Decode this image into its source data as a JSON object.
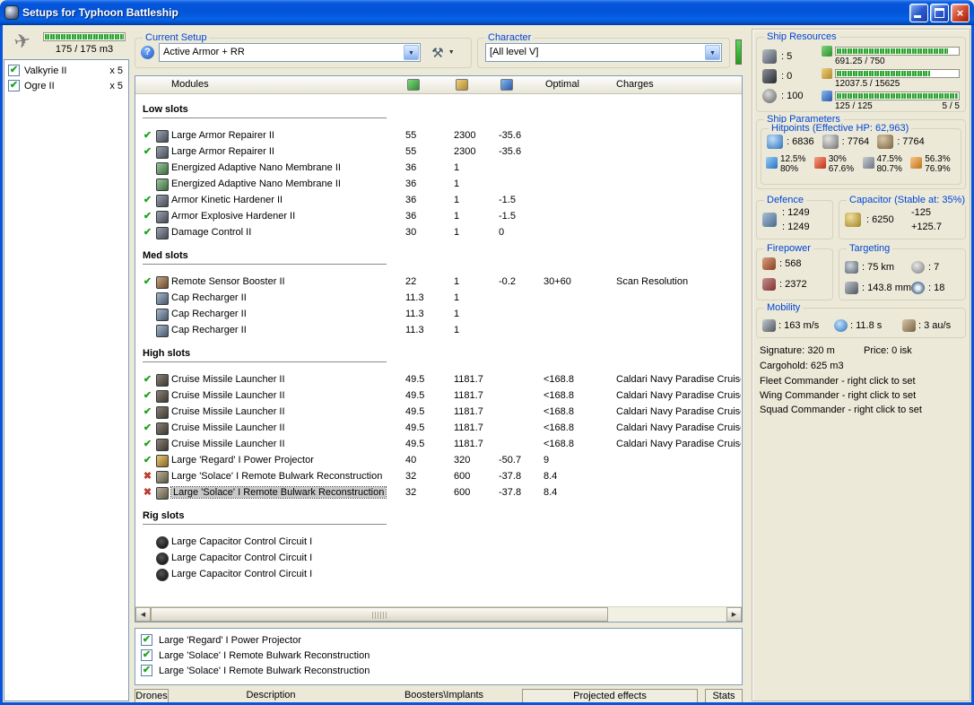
{
  "window": {
    "title": "Setups for Typhoon Battleship"
  },
  "drone_bay": {
    "capacity": "175 / 175 m3",
    "fill_pct": 100,
    "items": [
      {
        "name": "Valkyrie II",
        "qty": "x 5",
        "checked": true
      },
      {
        "name": "Ogre II",
        "qty": "x 5",
        "checked": true
      }
    ]
  },
  "setup": {
    "group_label": "Current Setup",
    "value": "Active Armor + RR"
  },
  "character": {
    "group_label": "Character",
    "value": "[All level V]"
  },
  "modules_table": {
    "header": {
      "modules": "Modules",
      "optimal": "Optimal",
      "charges": "Charges"
    },
    "sections": [
      {
        "title": "Low slots",
        "rows": [
          {
            "status": "ok",
            "icon": "armor-repairer-icon",
            "name": "Large Armor Repairer II",
            "cpu": "55",
            "pg": "2300",
            "cap": "-35.6"
          },
          {
            "status": "ok",
            "icon": "armor-repairer-icon",
            "name": "Large Armor Repairer II",
            "cpu": "55",
            "pg": "2300",
            "cap": "-35.6"
          },
          {
            "status": "",
            "icon": "nano-membrane-icon",
            "name": "Energized Adaptive Nano Membrane II",
            "cpu": "36",
            "pg": "1"
          },
          {
            "status": "",
            "icon": "nano-membrane-icon",
            "name": "Energized Adaptive Nano Membrane II",
            "cpu": "36",
            "pg": "1"
          },
          {
            "status": "ok",
            "icon": "armor-hardener-icon",
            "name": "Armor Kinetic Hardener II",
            "cpu": "36",
            "pg": "1",
            "cap": "-1.5"
          },
          {
            "status": "ok",
            "icon": "armor-hardener-icon",
            "name": "Armor Explosive Hardener II",
            "cpu": "36",
            "pg": "1",
            "cap": "-1.5"
          },
          {
            "status": "ok",
            "icon": "damage-control-icon",
            "name": "Damage Control II",
            "cpu": "30",
            "pg": "1",
            "cap": "0"
          }
        ]
      },
      {
        "title": "Med slots",
        "rows": [
          {
            "status": "ok",
            "icon": "sensor-booster-icon",
            "name": "Remote Sensor Booster II",
            "cpu": "22",
            "pg": "1",
            "cap": "-0.2",
            "optimal": "30+60",
            "charges": "Scan Resolution"
          },
          {
            "status": "",
            "icon": "cap-recharger-icon",
            "name": "Cap Recharger II",
            "cpu": "11.3",
            "pg": "1"
          },
          {
            "status": "",
            "icon": "cap-recharger-icon",
            "name": "Cap Recharger II",
            "cpu": "11.3",
            "pg": "1"
          },
          {
            "status": "",
            "icon": "cap-recharger-icon",
            "name": "Cap Recharger II",
            "cpu": "11.3",
            "pg": "1"
          }
        ]
      },
      {
        "title": "High slots",
        "rows": [
          {
            "status": "ok",
            "icon": "missile-launcher-icon",
            "name": "Cruise Missile Launcher II",
            "cpu": "49.5",
            "pg": "1181.7",
            "optimal": "<168.8",
            "charges": "Caldari Navy Paradise Cruise M"
          },
          {
            "status": "ok",
            "icon": "missile-launcher-icon",
            "name": "Cruise Missile Launcher II",
            "cpu": "49.5",
            "pg": "1181.7",
            "optimal": "<168.8",
            "charges": "Caldari Navy Paradise Cruise M"
          },
          {
            "status": "ok",
            "icon": "missile-launcher-icon",
            "name": "Cruise Missile Launcher II",
            "cpu": "49.5",
            "pg": "1181.7",
            "optimal": "<168.8",
            "charges": "Caldari Navy Paradise Cruise M"
          },
          {
            "status": "ok",
            "icon": "missile-launcher-icon",
            "name": "Cruise Missile Launcher II",
            "cpu": "49.5",
            "pg": "1181.7",
            "optimal": "<168.8",
            "charges": "Caldari Navy Paradise Cruise M"
          },
          {
            "status": "ok",
            "icon": "missile-launcher-icon",
            "name": "Cruise Missile Launcher II",
            "cpu": "49.5",
            "pg": "1181.7",
            "optimal": "<168.8",
            "charges": "Caldari Navy Paradise Cruise M"
          },
          {
            "status": "ok",
            "icon": "power-projector-icon",
            "name": "Large 'Regard' I Power Projector",
            "cpu": "40",
            "pg": "320",
            "cap": "-50.7",
            "optimal": "9"
          },
          {
            "status": "error",
            "icon": "remote-armor-repair-icon",
            "name": "Large 'Solace' I Remote Bulwark Reconstruction",
            "cpu": "32",
            "pg": "600",
            "cap": "-37.8",
            "optimal": "8.4"
          },
          {
            "status": "error",
            "icon": "remote-armor-repair-icon",
            "name": "Large 'Solace' I Remote Bulwark Reconstruction",
            "cpu": "32",
            "pg": "600",
            "cap": "-37.8",
            "optimal": "8.4",
            "selected": true
          }
        ]
      },
      {
        "title": "Rig slots",
        "rows": [
          {
            "status": "",
            "icon": "rig-icon",
            "name": "Large Capacitor Control Circuit I"
          },
          {
            "status": "",
            "icon": "rig-icon",
            "name": "Large Capacitor Control Circuit I"
          },
          {
            "status": "",
            "icon": "rig-icon",
            "name": "Large Capacitor Control Circuit I"
          }
        ]
      }
    ]
  },
  "projected_effects": {
    "items": [
      {
        "name": "Large 'Regard' I Power Projector",
        "checked": true
      },
      {
        "name": "Large 'Solace' I Remote Bulwark Reconstruction",
        "checked": true
      },
      {
        "name": "Large 'Solace' I Remote Bulwark Reconstruction",
        "checked": true
      }
    ]
  },
  "tabs": {
    "drones": "Drones",
    "description": "Description",
    "boosters": "Boosters\\Implants",
    "projected": "Projected effects",
    "stats": "Stats"
  },
  "ship_resources": {
    "group_label": "Ship Resources",
    "turrets": ": 5",
    "launchers": ": 0",
    "calibration": ": 100",
    "cpu_text": "691.25 / 750",
    "cpu_pct": 92,
    "powergrid_text": "12037.5 / 15625",
    "powergrid_pct": 77,
    "drone_text": "125 / 125",
    "drone_pct": 100,
    "slots_text": "5 / 5"
  },
  "ship_parameters": {
    "group_label": "Ship Parameters",
    "hitpoints": {
      "group_label": "Hitpoints (Effective HP: 62,963)",
      "shield": ": 6836",
      "armor": ": 7764",
      "hull": ": 7764",
      "resists": [
        {
          "type": "em",
          "shield": "12.5%",
          "armor": "80%"
        },
        {
          "type": "thermal",
          "shield": "30%",
          "armor": "67.6%"
        },
        {
          "type": "kinetic",
          "shield": "47.5%",
          "armor": "80.7%"
        },
        {
          "type": "explosive",
          "shield": "56.3%",
          "armor": "76.9%"
        }
      ]
    }
  },
  "defence": {
    "group_label": "Defence",
    "top": ": 1249",
    "bottom": ": 1249"
  },
  "capacitor": {
    "group_label": "Capacitor (Stable at: 35%)",
    "amount": ": 6250",
    "usage": "-125",
    "recharge": "+125.7"
  },
  "firepower": {
    "group_label": "Firepower",
    "volley": ": 568",
    "dps": ": 2372"
  },
  "targeting": {
    "group_label": "Targeting",
    "range": ": 75 km",
    "max_targets": ": 7",
    "scan_resolution": ": 143.8 mm",
    "sensor_strength": ": 18"
  },
  "mobility": {
    "group_label": "Mobility",
    "max_velocity": ": 163 m/s",
    "align_time": ": 11.8 s",
    "warp_speed": ": 3 au/s"
  },
  "footer": {
    "signature": "Signature: 320 m",
    "price": "Price: 0 isk",
    "cargohold": "Cargohold: 625 m3",
    "fleet": "Fleet Commander - right click to set",
    "wing": "Wing Commander - right click to set",
    "squad": "Squad Commander - right click to set"
  }
}
